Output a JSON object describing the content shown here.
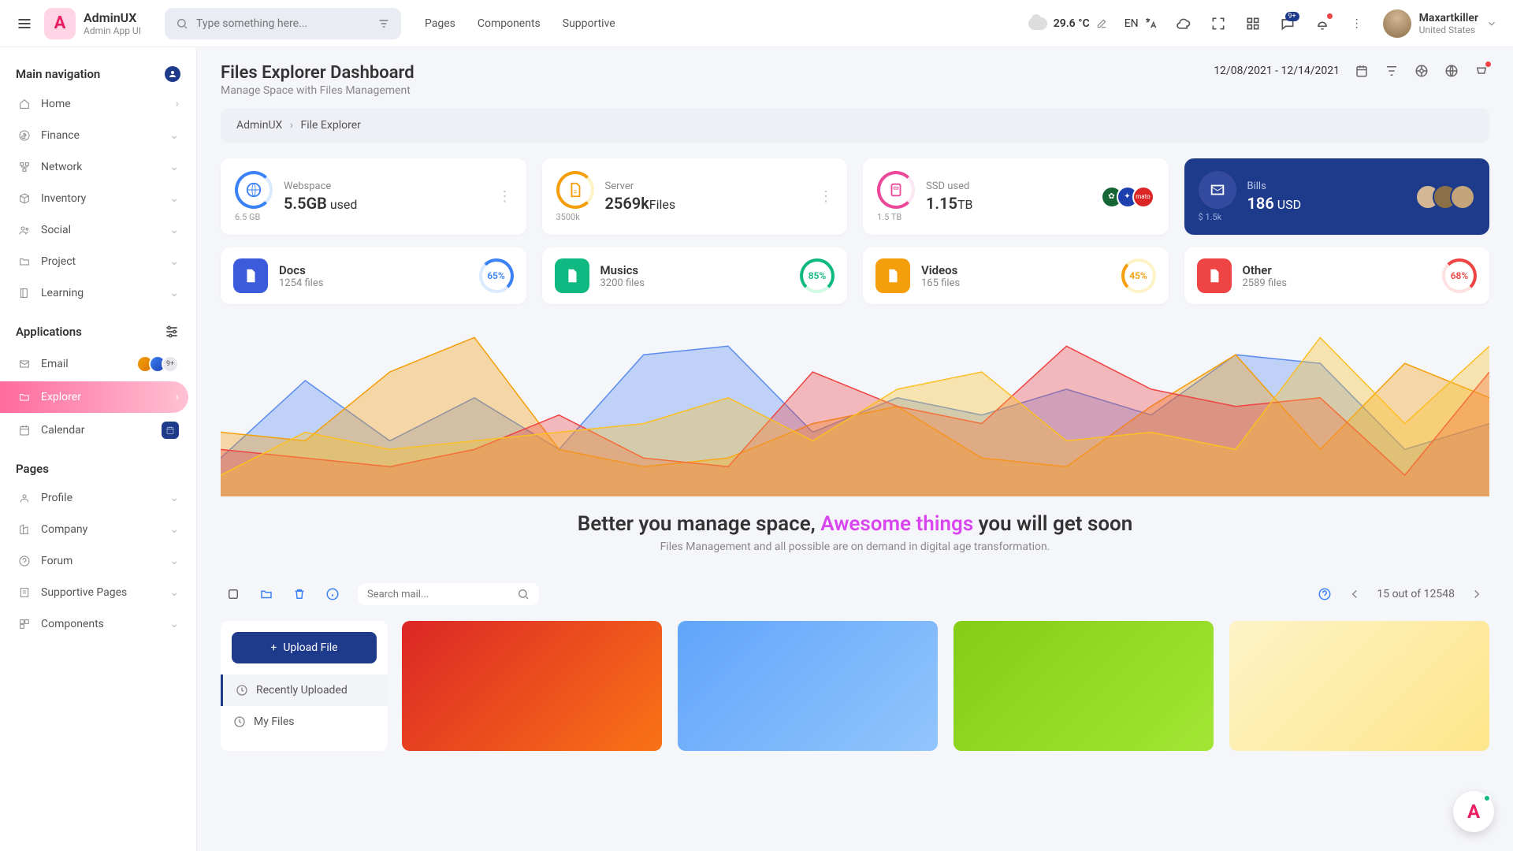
{
  "brand": {
    "name": "AdminUX",
    "sub": "Admin App UI",
    "logo": "A"
  },
  "search": {
    "placeholder": "Type something here..."
  },
  "topnav": [
    "Pages",
    "Components",
    "Supportive"
  ],
  "weather": {
    "temp": "29.6 °C"
  },
  "lang": "EN",
  "msg_badge": "9+",
  "user": {
    "name": "Maxartkiller",
    "loc": "United States"
  },
  "sidebar": {
    "main_title": "Main navigation",
    "nav": [
      {
        "label": "Home",
        "icon": "home"
      },
      {
        "label": "Finance",
        "icon": "dollar"
      },
      {
        "label": "Network",
        "icon": "network"
      },
      {
        "label": "Inventory",
        "icon": "box"
      },
      {
        "label": "Social",
        "icon": "users"
      },
      {
        "label": "Project",
        "icon": "folder"
      },
      {
        "label": "Learning",
        "icon": "book"
      }
    ],
    "apps_title": "Applications",
    "apps": [
      {
        "label": "Email",
        "trail": "avatars"
      },
      {
        "label": "Explorer",
        "active": true
      },
      {
        "label": "Calendar",
        "trail": "cal"
      }
    ],
    "pages_title": "Pages",
    "pages": [
      {
        "label": "Profile"
      },
      {
        "label": "Company"
      },
      {
        "label": "Forum"
      },
      {
        "label": "Supportive Pages"
      },
      {
        "label": "Components"
      }
    ]
  },
  "page": {
    "title": "Files Explorer Dashboard",
    "subtitle": "Manage Space with Files Management",
    "daterange": "12/08/2021 - 12/14/2021",
    "crumb_root": "AdminUX",
    "crumb_leaf": "File Explorer"
  },
  "stats": [
    {
      "label": "Webspace",
      "value": "5.5GB",
      "suffix": " used",
      "sub": "6.5 GB",
      "ring": "blue"
    },
    {
      "label": "Server",
      "value": "2569k",
      "suffix": "Files",
      "sub": "3500k",
      "ring": "yellow"
    },
    {
      "label": "SSD used",
      "value": "1.15",
      "suffix": "TB",
      "sub": "1.5 TB",
      "ring": "pink",
      "brands": true
    },
    {
      "label": "Bills",
      "value": "186",
      "suffix": " USD",
      "sub": "$ 1.5k",
      "ring": "darkb",
      "dark": true,
      "people": true
    }
  ],
  "types": [
    {
      "title": "Docs",
      "count": "1254 files",
      "pct": "65%",
      "color": "blue"
    },
    {
      "title": "Musics",
      "count": "3200 files",
      "pct": "85%",
      "color": "green"
    },
    {
      "title": "Videos",
      "count": "165 files",
      "pct": "45%",
      "color": "yellow"
    },
    {
      "title": "Other",
      "count": "2589 files",
      "pct": "68%",
      "color": "red"
    }
  ],
  "chart_data": {
    "type": "area",
    "xlabel": "",
    "ylabel": "",
    "x_range": [
      0,
      100
    ],
    "y_range": [
      0,
      100
    ],
    "series": [
      {
        "name": "blue",
        "color": "#5b8def",
        "values": [
          20,
          65,
          30,
          55,
          25,
          80,
          85,
          35,
          55,
          45,
          60,
          45,
          80,
          75,
          25,
          40
        ]
      },
      {
        "name": "orange",
        "color": "#f59e0b",
        "values": [
          35,
          30,
          70,
          90,
          25,
          15,
          20,
          40,
          50,
          20,
          15,
          50,
          80,
          25,
          75,
          55
        ]
      },
      {
        "name": "red",
        "color": "#ef4444",
        "values": [
          25,
          20,
          15,
          25,
          45,
          20,
          15,
          70,
          50,
          40,
          85,
          60,
          50,
          55,
          10,
          70
        ]
      },
      {
        "name": "yellow",
        "color": "#fbbf24",
        "values": [
          10,
          35,
          25,
          30,
          35,
          40,
          55,
          30,
          60,
          70,
          30,
          35,
          25,
          90,
          40,
          85
        ]
      }
    ]
  },
  "hero": {
    "pre": "Better you manage space, ",
    "hl": "Awesome things",
    "post": " you will get soon",
    "sub": "Files Management and all possible are on demand in digital age transformation."
  },
  "files_toolbar": {
    "search_placeholder": "Search mail...",
    "pager": "15 out of 12548"
  },
  "files_side": {
    "upload": "Upload File",
    "items": [
      {
        "label": "Recently Uploaded",
        "active": true
      },
      {
        "label": "My Files"
      }
    ]
  },
  "mini_more": "9+"
}
